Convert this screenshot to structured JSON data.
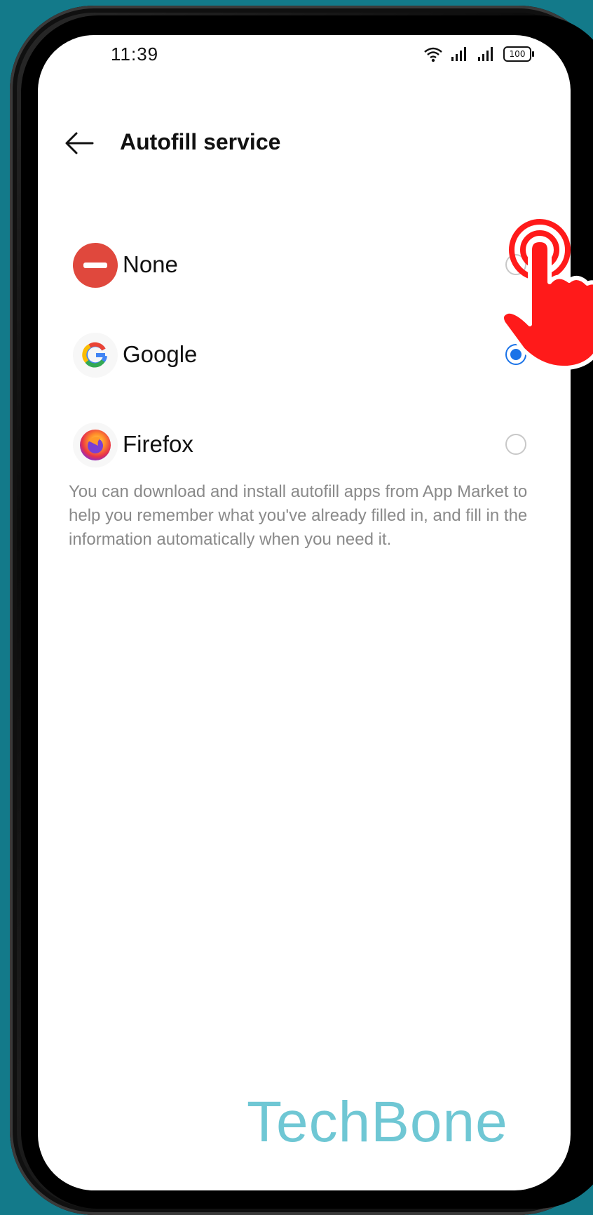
{
  "status_bar": {
    "time": "11:39",
    "battery": "100"
  },
  "app_bar": {
    "title": "Autofill service"
  },
  "options": [
    {
      "label": "None",
      "icon": "no-entry-icon",
      "selected": false
    },
    {
      "label": "Google",
      "icon": "google-icon",
      "selected": true
    },
    {
      "label": "Firefox",
      "icon": "firefox-icon",
      "selected": false
    }
  ],
  "description": "You can download and install autofill apps from App Market to help you remember what you've already filled in, and fill in the information automatically when you need it.",
  "watermark": "TechBone",
  "colors": {
    "background": "#137a8a",
    "accent": "#1a73e8",
    "none_icon": "#e0483d",
    "tap_hand": "#ff1a1a",
    "watermark": "#6fc7d4"
  }
}
